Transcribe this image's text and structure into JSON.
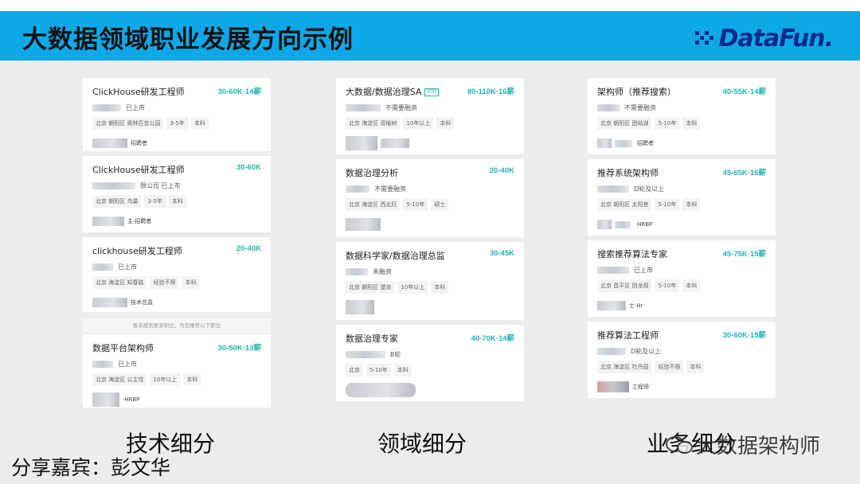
{
  "header": {
    "title": "大数据领域职业发展方向示例",
    "logo_text": "DataFun."
  },
  "columns": [
    {
      "caption": "技术细分",
      "cards": [
        {
          "title": "ClickHouse研发工程师",
          "tag": "",
          "salary": "30-60K·14薪",
          "company": "已上市",
          "tags": [
            "北京 朝阳区 奥林匹克公园",
            "3-5年",
            "本科"
          ],
          "recruiter": "招聘者"
        },
        {
          "title": "ClickHouse研发工程师",
          "tag": "",
          "salary": "30-60K",
          "company": "限公司  已上市",
          "tags": [
            "北京 朝阳区 鸟巢",
            "3-5年",
            "本科"
          ],
          "recruiter": "主·招聘者"
        },
        {
          "title": "clickhouse研发工程师",
          "tag": "",
          "salary": "20-40K",
          "company": "已上市",
          "tags": [
            "北京 海淀区 知春路",
            "经验不限",
            "本科"
          ],
          "recruiter": "技术总监"
        },
        {
          "title": "数据平台架构师",
          "tag": "",
          "salary": "30-50K·13薪",
          "company": "已上市",
          "tags": [
            "北京 海淀区 公主坟",
            "10年以上",
            "本科"
          ],
          "recruiter": "·HRBP"
        }
      ],
      "note": "暂未搜到更多职位，为您推荐以下职位"
    },
    {
      "caption": "领域细分",
      "cards": [
        {
          "title": "大数据/数据治理SA",
          "tag": "可转",
          "salary": "80-110K·16薪",
          "company": "不需要融资",
          "tags": [
            "北京 海淀区 双榆树",
            "10年以上",
            "本科"
          ],
          "recruiter": ""
        },
        {
          "title": "数据治理分析",
          "tag": "",
          "salary": "20-40K",
          "company": "不需要融资",
          "tags": [
            "北京 海淀区 西北旺",
            "5-10年",
            "硕士"
          ],
          "recruiter": ""
        },
        {
          "title": "数据科学家/数据治理总监",
          "tag": "",
          "salary": "30-45K",
          "company": "未融资",
          "tags": [
            "北京 朝阳区 望京",
            "10年以上",
            "本科"
          ],
          "recruiter": ""
        },
        {
          "title": "数据治理专家",
          "tag": "",
          "salary": "40-70K·14薪",
          "company": "B轮",
          "tags": [
            "北京",
            "5-10年",
            "本科"
          ],
          "recruiter": ""
        }
      ]
    },
    {
      "caption": "业务细分",
      "cards": [
        {
          "title": "架构师（推荐搜索）",
          "tag": "",
          "salary": "40-55K·14薪",
          "company": "不需要融资",
          "tags": [
            "北京 朝阳区 团结湖",
            "5-10年",
            "本科"
          ],
          "recruiter": "招聘者"
        },
        {
          "title": "推荐系统架构师",
          "tag": "",
          "salary": "45-65K·16薪",
          "company": "D轮及以上",
          "tags": [
            "北京 朝阳区 太阳宫",
            "5-10年",
            "本科"
          ],
          "recruiter": "·HRBP"
        },
        {
          "title": "搜索推荐算法专家",
          "tag": "",
          "salary": "45-75K·15薪",
          "company": "已上市",
          "tags": [
            "北京 昌平区 回龙观",
            "5-10年",
            "本科"
          ],
          "recruiter": "士·Hr"
        },
        {
          "title": "推荐算法工程师",
          "tag": "",
          "salary": "30-60K·15薪",
          "company": "D轮及以上",
          "tags": [
            "北京 海淀区 牡丹园",
            "经验不限",
            "本科"
          ],
          "recruiter": "工程师"
        }
      ]
    }
  ],
  "speaker": "分享嘉宾：彭文华",
  "watermark": "大数据架构师",
  "colors": {
    "header_bg": "#0da8e8",
    "salary": "#22b5b0",
    "logo": "#0a2a8a"
  }
}
